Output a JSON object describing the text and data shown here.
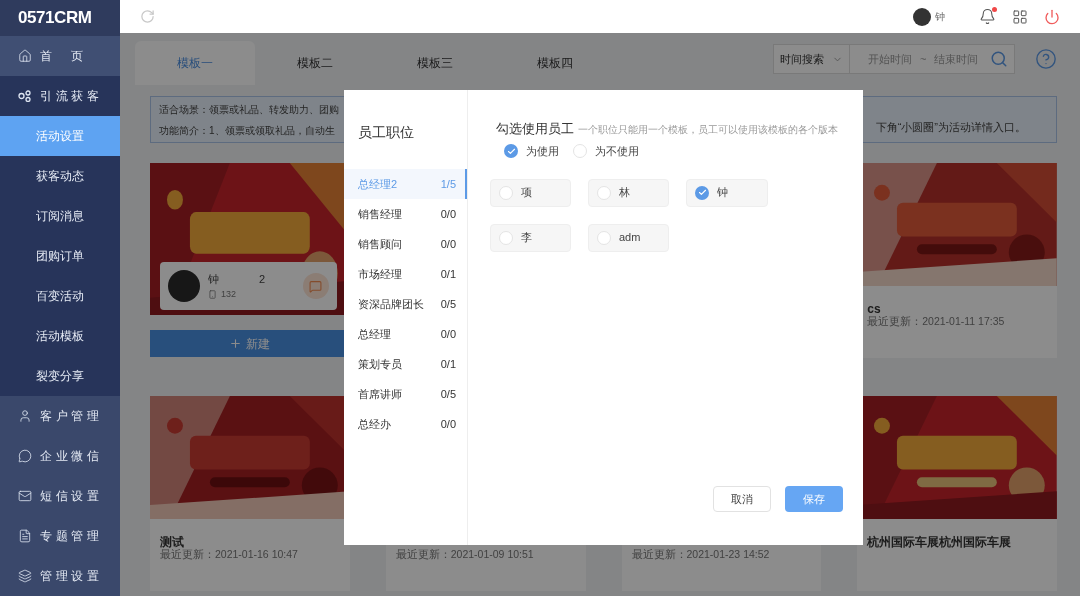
{
  "logo": "0571CRM",
  "sidebar": {
    "items": [
      {
        "label": "首页",
        "kind": "link"
      },
      {
        "label": "引流获客",
        "kind": "group",
        "expanded": true,
        "children": [
          {
            "label": "活动设置",
            "selected": true
          },
          {
            "label": "获客动态",
            "selected": false
          },
          {
            "label": "订阅消息",
            "selected": false
          },
          {
            "label": "团购订单",
            "selected": false
          },
          {
            "label": "百变活动",
            "selected": false
          },
          {
            "label": "活动模板",
            "selected": false
          },
          {
            "label": "裂变分享",
            "selected": false
          }
        ]
      },
      {
        "label": "客户管理",
        "kind": "group",
        "expanded": false
      },
      {
        "label": "企业微信",
        "kind": "group",
        "expanded": false
      },
      {
        "label": "短信设置",
        "kind": "group",
        "expanded": false
      },
      {
        "label": "专题管理",
        "kind": "group",
        "expanded": false
      },
      {
        "label": "管理设置",
        "kind": "group",
        "expanded": false
      }
    ]
  },
  "header": {
    "user_name": "钟",
    "unread": true
  },
  "tabs": [
    {
      "label": "模板一",
      "selected": true
    },
    {
      "label": "模板二",
      "selected": false
    },
    {
      "label": "模板三",
      "selected": false
    },
    {
      "label": "模板四",
      "selected": false
    }
  ],
  "search": {
    "mode": "时间搜索",
    "start_placeholder": "开始时间",
    "separator": "~",
    "end_placeholder": "结束时间"
  },
  "info_box": {
    "left_lines": [
      "适合场景：领票或礼品、转发助力、团购",
      "功能简介：1、领票或领取礼品，自动生"
    ],
    "right_text": "下角“小圆圈”为活动详情入口。"
  },
  "card_rows": [
    {
      "cards": [
        {
          "kind": "creator",
          "name": "钟",
          "name_suffix": "2",
          "phone": "132",
          "button": "新建"
        },
        {
          "kind": "hidden"
        },
        {
          "kind": "hidden"
        },
        {
          "kind": "template",
          "title": "cs",
          "updated": "最近更新：2021-01-11 17:35"
        }
      ]
    },
    {
      "cards": [
        {
          "kind": "template",
          "title": "测试",
          "updated": "最近更新：2021-01-16 10:47"
        },
        {
          "kind": "partial",
          "updated": "最近更新：2021-01-09 10:51"
        },
        {
          "kind": "partial",
          "updated": "最近更新：2021-01-23 14:52"
        },
        {
          "kind": "template",
          "title": "杭州国际车展杭州国际车展"
        }
      ]
    }
  ],
  "dialog": {
    "positions_title": "员工职位",
    "positions": [
      {
        "name": "总经理2",
        "count": "1/5",
        "selected": true
      },
      {
        "name": "销售经理",
        "count": "0/0",
        "selected": false
      },
      {
        "name": "销售顾问",
        "count": "0/0",
        "selected": false
      },
      {
        "name": "市场经理",
        "count": "0/1",
        "selected": false
      },
      {
        "name": "资深品牌团长",
        "count": "0/5",
        "selected": false
      },
      {
        "name": "总经理",
        "count": "0/0",
        "selected": false
      },
      {
        "name": "策划专员",
        "count": "0/1",
        "selected": false
      },
      {
        "name": "首席讲师",
        "count": "0/5",
        "selected": false
      },
      {
        "name": "总经办",
        "count": "0/0",
        "selected": false
      }
    ],
    "employees_title": "勾选使用员工",
    "hint": "一个职位只能用一个模板，员工可以使用该模板的各个版本",
    "legend": [
      {
        "label": "为使用",
        "checked": true
      },
      {
        "label": "为不使用",
        "checked": false
      }
    ],
    "employees": [
      {
        "name": "项",
        "checked": false
      },
      {
        "name": "林",
        "checked": false
      },
      {
        "name": "钟",
        "checked": true
      },
      {
        "name": "李",
        "checked": false
      },
      {
        "name": "adm",
        "checked": false
      }
    ],
    "buttons": [
      {
        "label": "取消",
        "kind": "secondary"
      },
      {
        "label": "保存",
        "kind": "primary"
      }
    ]
  }
}
